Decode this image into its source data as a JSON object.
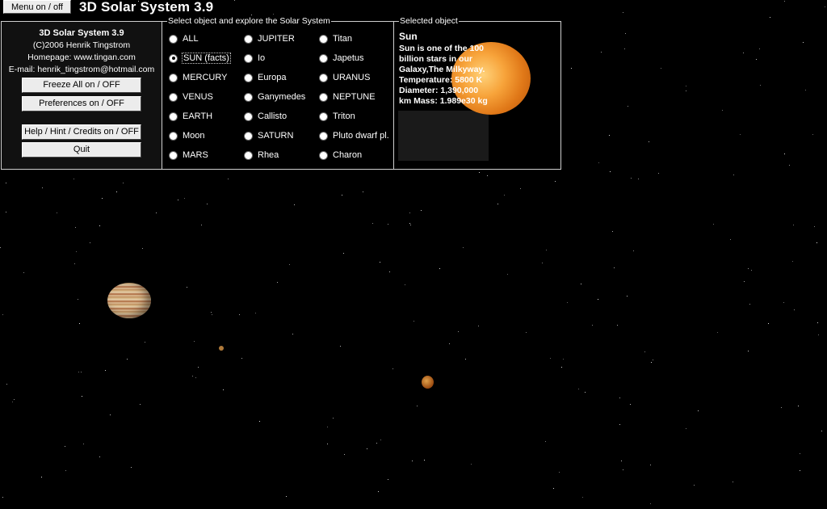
{
  "app": {
    "menu_button_label": "Menu on / off",
    "title": "3D Solar System 3.9"
  },
  "info_panel": {
    "app_name": "3D Solar System 3.9",
    "copyright": "(C)2006 Henrik Tingstrom",
    "homepage": "Homepage: www.tingan.com",
    "email": "E-mail: henrik_tingstrom@hotmail.com",
    "buttons": {
      "freeze": "Freeze All on / OFF",
      "preferences": "Preferences on / OFF",
      "help": "Help / Hint / Credits on / OFF",
      "quit": "Quit"
    }
  },
  "select_panel": {
    "legend": "Select object and explore the Solar System",
    "columns": [
      [
        "ALL",
        "SUN (facts)",
        "MERCURY",
        "VENUS",
        "EARTH",
        "Moon",
        "MARS"
      ],
      [
        "JUPITER",
        "Io",
        "Europa",
        "Ganymedes",
        "Callisto",
        "SATURN",
        "Rhea"
      ],
      [
        "Titan",
        "Japetus",
        "URANUS",
        "NEPTUNE",
        "Triton",
        "Pluto dwarf pl.",
        "Charon"
      ]
    ],
    "selected": "SUN (facts)"
  },
  "selected_panel": {
    "legend": "Selected object",
    "name": "Sun",
    "description": "Sun is one of the 100 billion stars in our Galaxy,The Milkyway. Temperature: 5800 K Diameter: 1,390,000 km Mass: 1.989e30 kg"
  },
  "colors": {
    "background": "#000000",
    "panel_border": "#cfcfcf",
    "button_face": "#ececec"
  }
}
